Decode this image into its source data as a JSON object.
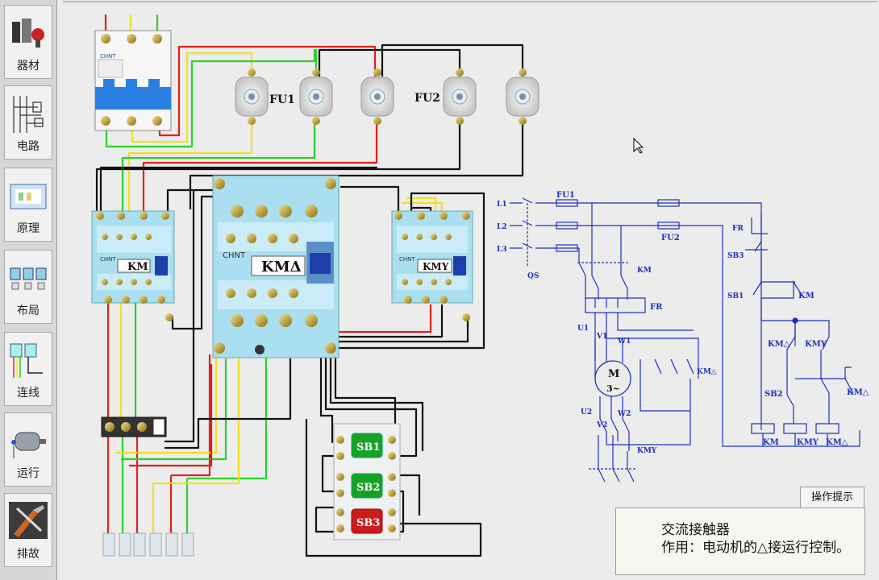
{
  "sidebar": {
    "items": [
      {
        "label": "器材",
        "icon": "equipment-icon"
      },
      {
        "label": "电路",
        "icon": "circuit-icon"
      },
      {
        "label": "原理",
        "icon": "principle-icon"
      },
      {
        "label": "布局",
        "icon": "layout-icon"
      },
      {
        "label": "连线",
        "icon": "wiring-icon"
      },
      {
        "label": "运行",
        "icon": "motor-run-icon"
      },
      {
        "label": "排故",
        "icon": "troubleshoot-icon"
      }
    ]
  },
  "wiring": {
    "breaker_brand": "CHNT",
    "fu1": "FU1",
    "fu2": "FU2",
    "km_label": "KM",
    "km_delta_label": "KMΔ",
    "kmy_label": "KMY",
    "sb1": "SB1",
    "sb2": "SB2",
    "sb3": "SB3",
    "chnt": "CHNT"
  },
  "schematic": {
    "l1": "L1",
    "l2": "L2",
    "l3": "L3",
    "qs": "QS",
    "fu1": "FU1",
    "fu2": "FU2",
    "km": "KM",
    "fr": "FR",
    "u1": "U1",
    "v1": "V1",
    "w1": "W1",
    "motor_m": "M",
    "motor_3": "3~",
    "u2": "U2",
    "v2": "V2",
    "w2": "W2",
    "km_delta": "KM△",
    "kmy": "KMY",
    "ctrl_fr": "FR",
    "sb3": "SB3",
    "sb1": "SB1",
    "ctrl_km": "KM",
    "ctrl_km_delta": "KM△",
    "ctrl_kmy": "KMY",
    "sb2": "SB2",
    "ctrl_km_delta2": "KM△",
    "coil_km": "KM",
    "coil_kmy": "KMY",
    "coil_km_delta": "KM△"
  },
  "hint": {
    "tab_label": "操作提示",
    "title": "交流接触器",
    "body": "作用：电动机的△接运行控制。"
  },
  "colors": {
    "wire_red": "#e0201c",
    "wire_yellow": "#f0e020",
    "wire_green": "#2bd02b",
    "wire_black": "#111111",
    "contactor_body": "#a9dff0",
    "schematic_blue": "#1b2fbf"
  }
}
